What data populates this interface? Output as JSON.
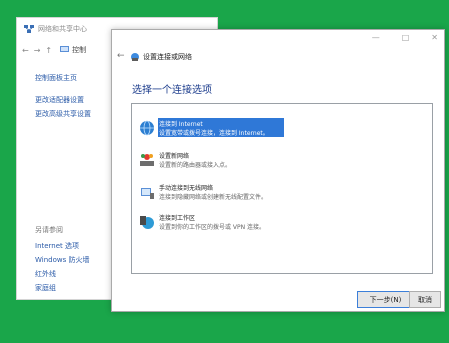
{
  "background_window": {
    "title": "网络和共享中心",
    "nav_arrows": [
      "←",
      "→",
      "↑"
    ],
    "breadcrumb": "控制",
    "links": [
      "控制面板主页",
      "更改适配器设置",
      "更改高级共享设置"
    ],
    "see_also_heading": "另请参阅",
    "see_also": [
      "Internet 选项",
      "Windows 防火墙",
      "红外线",
      "家庭组"
    ]
  },
  "dialog": {
    "controls": [
      "—",
      "□",
      "✕"
    ],
    "back_arrow": "←",
    "title": "设置连接或网络",
    "heading": "选择一个连接选项",
    "options": [
      {
        "icon": "globe-icon",
        "title": "连接到 Internet",
        "desc": "设置宽带或拨号连接，连接到 Internet。",
        "selected": true
      },
      {
        "icon": "router-icon",
        "title": "设置新网络",
        "desc": "设置新的路由器或接入点。",
        "selected": false
      },
      {
        "icon": "wireless-icon",
        "title": "手动连接到无线网络",
        "desc": "连接到隐藏网络或创建新无线配置文件。",
        "selected": false
      },
      {
        "icon": "workplace-icon",
        "title": "连接到工作区",
        "desc": "设置到你的工作区的拨号或 VPN 连接。",
        "selected": false
      }
    ],
    "next_button": "下一步(N)",
    "cancel_button": "取消"
  },
  "colors": {
    "desktop": "#1aa64a",
    "selection": "#2f78d7",
    "heading": "#1c3c8c",
    "link": "#2b5ba8"
  }
}
